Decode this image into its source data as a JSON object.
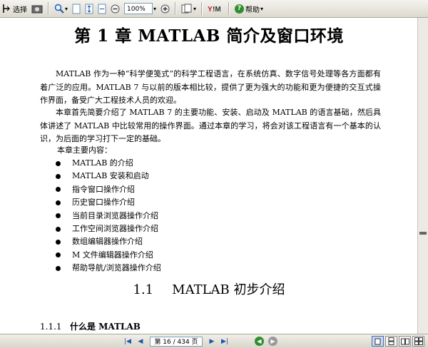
{
  "toolbar": {
    "select_label": "选择",
    "zoom_value": "100%",
    "help_label": "帮助"
  },
  "page": {
    "chapter_title": "第 1 章    MATLAB 简介及窗口环境",
    "paragraph1": "MATLAB 作为一种“科学便笺式”的科学工程语言，在系统仿真、数字信号处理等各方面都有着广泛的应用。MATLAB 7 与以前的版本相比较，提供了更为强大的功能和更为便捷的交互式操作界面，备受广大工程技术人员的欢迎。",
    "paragraph2": "本章首先简要介绍了 MATLAB 7 的主要功能、安装、启动及 MATLAB 的语言基础，然后具体讲述了 MATLAB 中比较常用的操作界面。通过本章的学习，将会对该工程语言有一个基本的认识，为后面的学习打下一定的基础。",
    "contents_label": "本章主要内容：",
    "contents": [
      {
        "text": "MATLAB 的介绍"
      },
      {
        "text": "MATLAB 安装和启动"
      },
      {
        "text": "指令窗口操作介绍"
      },
      {
        "text": "历史窗口操作介绍"
      },
      {
        "text": "当前目录浏览器操作介绍"
      },
      {
        "text": "工作空间浏览器操作介绍"
      },
      {
        "text": "数组编辑器操作介绍"
      },
      {
        "text": "M 文件编辑器操作介绍"
      },
      {
        "text": "帮助导航/浏览器操作介绍"
      }
    ],
    "section_number": "1.1",
    "section_title": "MATLAB 初步介绍",
    "subsection_number": "1.1.1",
    "subsection_title": "什么是 MATLAB"
  },
  "statusbar": {
    "page_indicator": "第 16 / 434 页"
  },
  "colors": {
    "accent": "#1a56b0",
    "back_green": "#2f8f2f",
    "yim_red": "#c8102e"
  }
}
